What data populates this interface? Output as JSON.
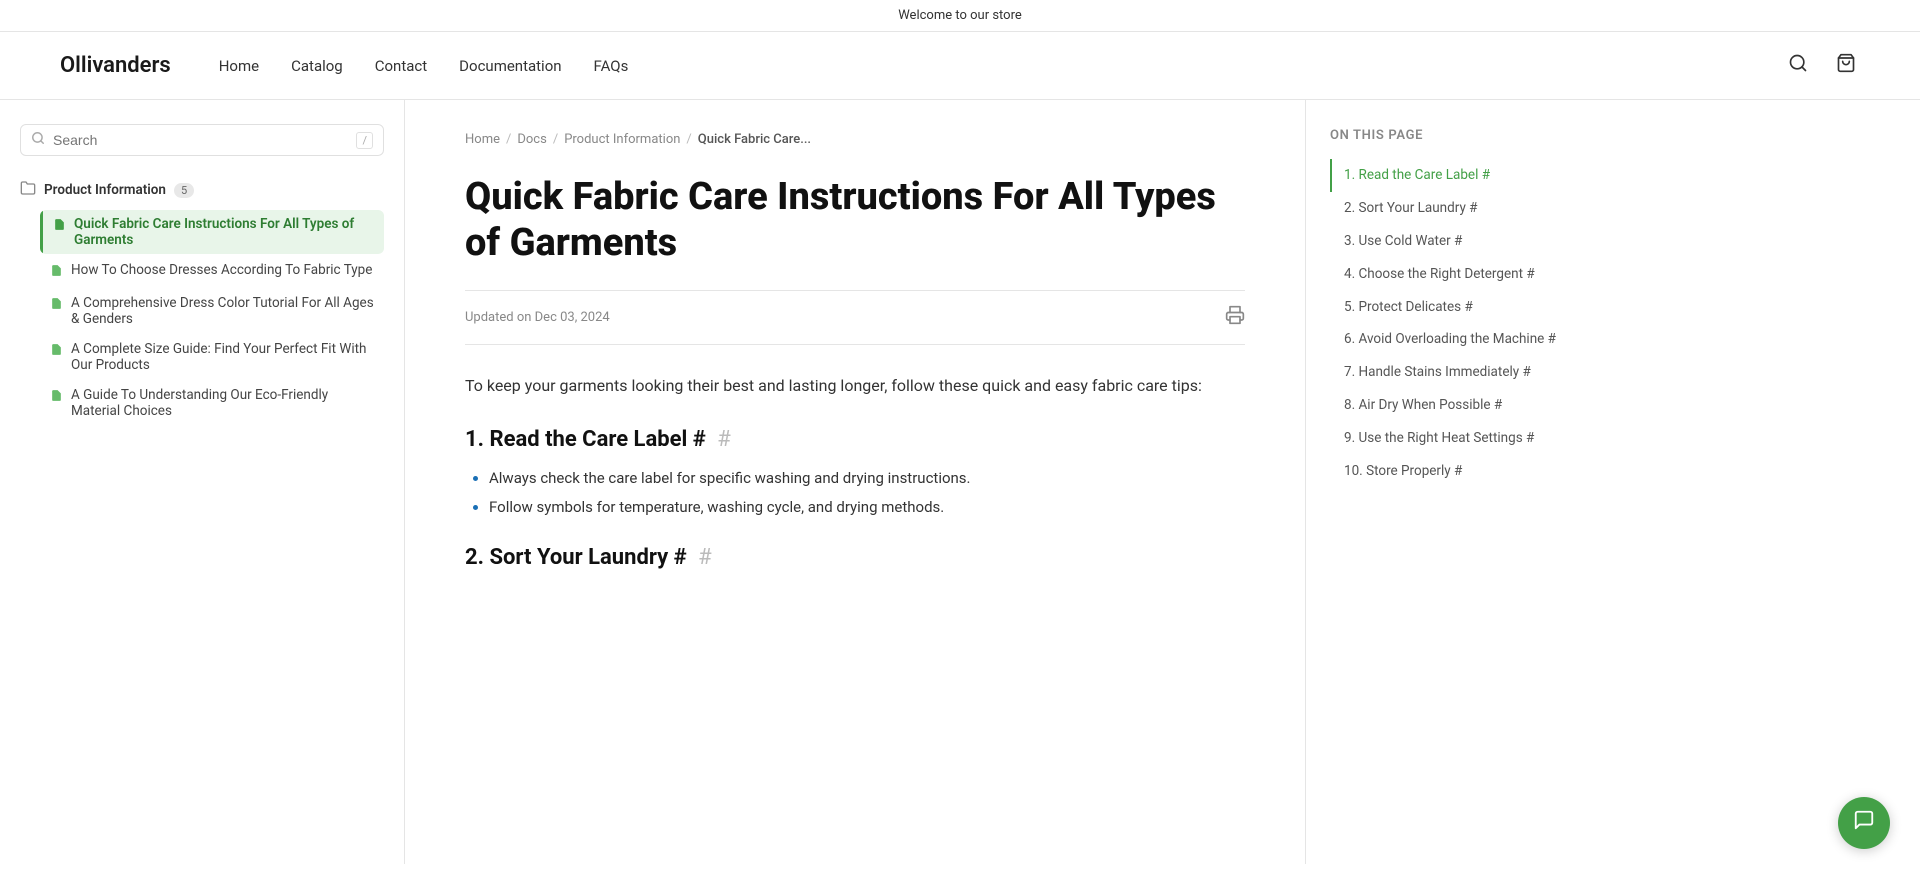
{
  "banner": {
    "text": "Welcome to our store"
  },
  "header": {
    "logo": "Ollivanders",
    "nav": [
      {
        "label": "Home",
        "href": "#"
      },
      {
        "label": "Catalog",
        "href": "#"
      },
      {
        "label": "Contact",
        "href": "#"
      },
      {
        "label": "Documentation",
        "href": "#"
      },
      {
        "label": "FAQs",
        "href": "#"
      }
    ],
    "search_icon": "🔍",
    "cart_icon": "🛍"
  },
  "sidebar": {
    "search_placeholder": "Search",
    "search_shortcut": "/",
    "section": {
      "title": "Product Information",
      "badge": "5",
      "icon": "📁"
    },
    "items": [
      {
        "label": "Quick Fabric Care Instructions For All Types of Garments",
        "active": true,
        "icon": "📄"
      },
      {
        "label": "How To Choose Dresses According To Fabric Type",
        "active": false,
        "icon": "📄"
      },
      {
        "label": "A Comprehensive Dress Color Tutorial For All Ages & Genders",
        "active": false,
        "icon": "📄"
      },
      {
        "label": "A Complete Size Guide: Find Your Perfect Fit With Our Products",
        "active": false,
        "icon": "📄"
      },
      {
        "label": "A Guide To Understanding Our Eco-Friendly Material Choices",
        "active": false,
        "icon": "📄"
      }
    ]
  },
  "breadcrumb": {
    "items": [
      {
        "label": "Home",
        "href": "#"
      },
      {
        "label": "Docs",
        "href": "#"
      },
      {
        "label": "Product Information",
        "href": "#"
      },
      {
        "label": "Quick Fabric Care...",
        "current": true
      }
    ]
  },
  "article": {
    "title": "Quick Fabric Care Instructions For All Types of Garments",
    "date": "Updated on Dec 03, 2024",
    "intro": "To keep your garments looking their best and lasting longer, follow these quick and easy fabric care tips:",
    "sections": [
      {
        "id": "read-care-label",
        "number": "1",
        "heading": "Read the Care Label #",
        "heading_hash": "#",
        "list_items": [
          "Always check the care label for specific washing and drying instructions.",
          "Follow symbols for temperature, washing cycle, and drying methods."
        ]
      },
      {
        "id": "sort-laundry",
        "number": "2",
        "heading": "Sort Your Laundry #",
        "heading_hash": "#",
        "list_items": []
      }
    ]
  },
  "toc": {
    "title": "On this Page",
    "items": [
      {
        "label": "1. Read the Care Label #",
        "active": true
      },
      {
        "label": "2. Sort Your Laundry #",
        "active": false
      },
      {
        "label": "3. Use Cold Water #",
        "active": false
      },
      {
        "label": "4. Choose the Right Detergent #",
        "active": false
      },
      {
        "label": "5. Protect Delicates #",
        "active": false
      },
      {
        "label": "6. Avoid Overloading the Machine #",
        "active": false
      },
      {
        "label": "7. Handle Stains Immediately #",
        "active": false
      },
      {
        "label": "8. Air Dry When Possible #",
        "active": false
      },
      {
        "label": "9. Use the Right Heat Settings #",
        "active": false
      },
      {
        "label": "10. Store Properly #",
        "active": false
      }
    ]
  },
  "chat": {
    "icon": "💬"
  }
}
